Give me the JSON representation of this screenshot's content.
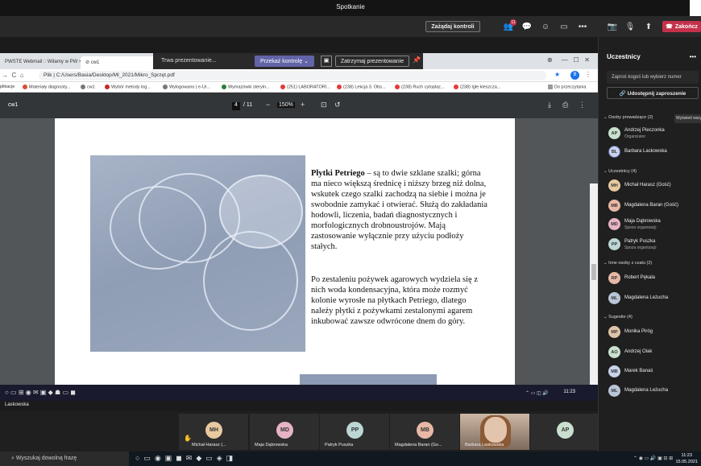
{
  "window": {
    "title": "Spotkanie"
  },
  "toolbar": {
    "control_label": "Zażądaj kontroli",
    "leave_label": "Zakończ",
    "participants_badge": "11"
  },
  "sharebar": {
    "presenting": "Trwa prezentowanie...",
    "pass_control": "Przekaż kontrolę",
    "stop": "Zatrzymaj prezentowanie"
  },
  "browser": {
    "tabs": [
      {
        "label": "PWSTE Webmail :: Witamy w PW"
      },
      {
        "label": "cw1"
      }
    ],
    "url": "Plik  |  C:/Users/Basia/Desktop/MI_2021/Mikro_Sprzęt.pdf",
    "profile": "B",
    "bookmarks": [
      "plikacje",
      "Materiały diagnosty...",
      "cw1",
      "Wybór metody log...",
      "Wylogowano | e-Ur...",
      "Wymazówki steryln...",
      "(251) LABORATORI...",
      "(238) Lekcja 3. Obs...",
      "(238) Ruch cytoplaz...",
      "(238) Igle kleszcza...",
      "Do przeczytania"
    ]
  },
  "pdf": {
    "name": "cw1",
    "page": "4",
    "pages": "/ 11",
    "zoom": "150%",
    "heading": "Płytki Petriego",
    "para1": " – są to dwie szklane szalki; górna ma nieco większą średnicę i niższy brzeg niż dolna, wskutek czego szalki zachodzą na siebie i można je swobodnie zamykać i otwierać. Służą do zakładania hodowli, liczenia, badań diagnostycznych i morfologicznych drobnoustrojów. Mają zastosowanie wyłącznie przy użyciu podłoży stałych.",
    "para2": "Po zestaleniu pożywek agarowych wydziela się z nich woda kondensacyjna, która może rozmyć kolonie wyrosłe na płytkach Petriego, dlatego należy płytki z pożywkami zestalonymi agarem inkubować zawsze odwrócone dnem do góry."
  },
  "remote_clock": "11:23",
  "presenter": {
    "name": "Laskowska"
  },
  "strip": [
    {
      "initials": "MH",
      "name": "Michał Harasz (...",
      "color": "#e8c9a0"
    },
    {
      "initials": "MD",
      "name": "Maja Dąbrowska",
      "color": "#e6b4c4"
    },
    {
      "initials": "PP",
      "name": "Patryk Puszka",
      "color": "#bcd7d4"
    },
    {
      "initials": "MB",
      "name": "Magdalena Baran (Go...",
      "color": "#e8b8a6"
    },
    {
      "initials": "",
      "name": "Barbara Laskowska",
      "color": ""
    },
    {
      "initials": "AP",
      "name": "",
      "color": "#c9e0cf"
    }
  ],
  "panel": {
    "title": "Uczestnicy",
    "invite_placeholder": "Zaproś kogoś lub wybierz numer",
    "share_label": "Udostępnij zaproszenie",
    "show_all": "Wyświetl wszystko",
    "sections": [
      {
        "label": "Osoby prowadzące (2)",
        "people": [
          {
            "initials": "AP",
            "name": "Andrzej Pieczonka",
            "sub": "Organizator",
            "color": "#c9e0cf"
          },
          {
            "initials": "BL",
            "name": "Barbara Laskowska",
            "sub": "",
            "color": "#c7d3ea"
          }
        ]
      },
      {
        "label": "Uczestnicy (4)",
        "people": [
          {
            "initials": "MH",
            "name": "Michał Harasz (Gość)",
            "sub": "",
            "color": "#e8c9a0"
          },
          {
            "initials": "MB",
            "name": "Magdalena Baran (Gość)",
            "sub": "",
            "color": "#e8b8a6"
          },
          {
            "initials": "MD",
            "name": "Maja Dąbrowska",
            "sub": "Spoza organizacji",
            "color": "#e6b4c4"
          },
          {
            "initials": "PP",
            "name": "Patryk Puszka",
            "sub": "Spoza organizacji",
            "color": "#bcd7d4"
          }
        ]
      },
      {
        "label": "Inne osoby z czatu (2)",
        "people": [
          {
            "initials": "RP",
            "name": "Robert Pękala",
            "sub": "",
            "color": "#e8b8a6"
          },
          {
            "initials": "ML",
            "name": "Magdalena Leżucha",
            "sub": "",
            "color": "#b9c5d6"
          }
        ]
      },
      {
        "label": "Sugestie (4)",
        "people": [
          {
            "initials": "MP",
            "name": "Monika Piróg",
            "sub": "",
            "color": "#e0c4a8"
          },
          {
            "initials": "AO",
            "name": "Andrzej Olak",
            "sub": "",
            "color": "#c9e0cf"
          },
          {
            "initials": "MB",
            "name": "Marek Banaś",
            "sub": "",
            "color": "#c7d3ea"
          },
          {
            "initials": "ML",
            "name": "Magdalena Leżucha",
            "sub": "",
            "color": "#b9c5d6"
          }
        ]
      }
    ]
  },
  "taskbar": {
    "search_placeholder": "Wyszukaj dowolną frazę",
    "time": "11:23",
    "date": "15.05.2021"
  }
}
